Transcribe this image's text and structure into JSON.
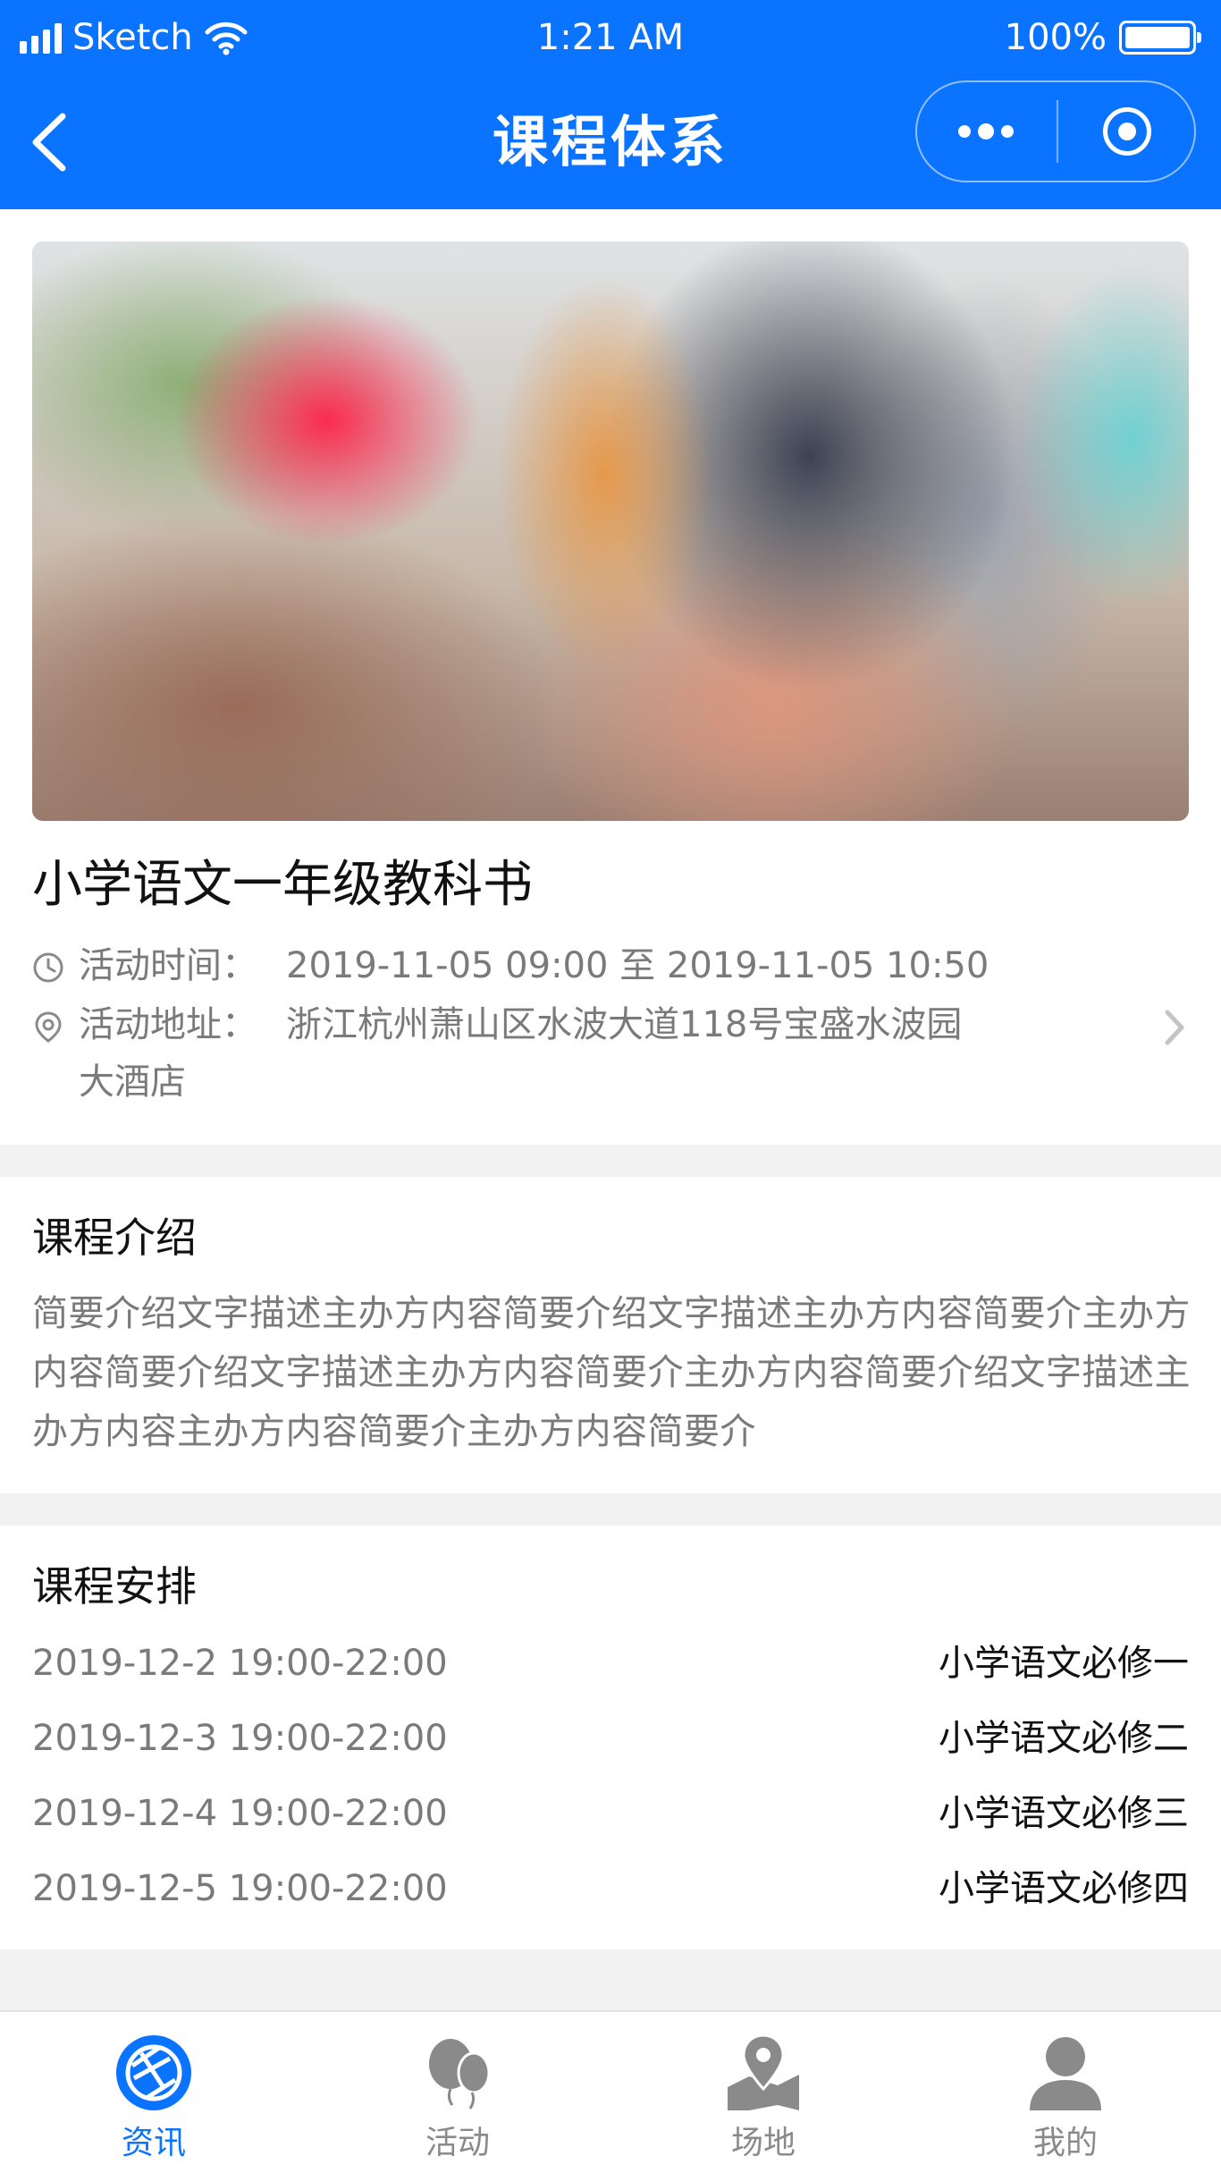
{
  "status_bar": {
    "carrier": "Sketch",
    "time": "1:21 AM",
    "battery": "100%",
    "battery_level": 1.0
  },
  "navbar": {
    "title": "课程体系",
    "back_icon": "chevron-left-icon",
    "more_icon": "more-dots-icon",
    "close_icon": "target-circle-icon"
  },
  "course": {
    "title": "小学语文一年级教科书",
    "time_label": "活动时间：",
    "time_value": "2019-11-05 09:00 至 2019-11-05 10:50",
    "address_label": "活动地址：",
    "address_line1": "浙江杭州萧山区水波大道118号宝盛水波园",
    "address_line2": "大酒店"
  },
  "intro": {
    "title": "课程介绍",
    "text": "简要介绍文字描述主办方内容简要介绍文字描述主办方内容简要介主办方内容简要介绍文字描述主办方内容简要介主办方内容简要介绍文字描述主办方内容主办方内容简要介主办方内容简要介"
  },
  "schedule": {
    "title": "课程安排",
    "items": [
      {
        "date": "2019-12-2 19:00-22:00",
        "name": "小学语文必修一"
      },
      {
        "date": "2019-12-3 19:00-22:00",
        "name": "小学语文必修二"
      },
      {
        "date": "2019-12-4 19:00-22:00",
        "name": "小学语文必修三"
      },
      {
        "date": "2019-12-5 19:00-22:00",
        "name": "小学语文必修四"
      }
    ]
  },
  "tabbar": {
    "active_color": "#0a73ff",
    "inactive_color": "#8a8a8a",
    "items": [
      {
        "label": "资讯",
        "icon": "aperture-icon",
        "active": true
      },
      {
        "label": "活动",
        "icon": "balloons-icon",
        "active": false
      },
      {
        "label": "场地",
        "icon": "map-pin-icon",
        "active": false
      },
      {
        "label": "我的",
        "icon": "user-icon",
        "active": false
      }
    ]
  },
  "colors": {
    "primary": "#0a73ff",
    "background": "#f2f2f2"
  }
}
